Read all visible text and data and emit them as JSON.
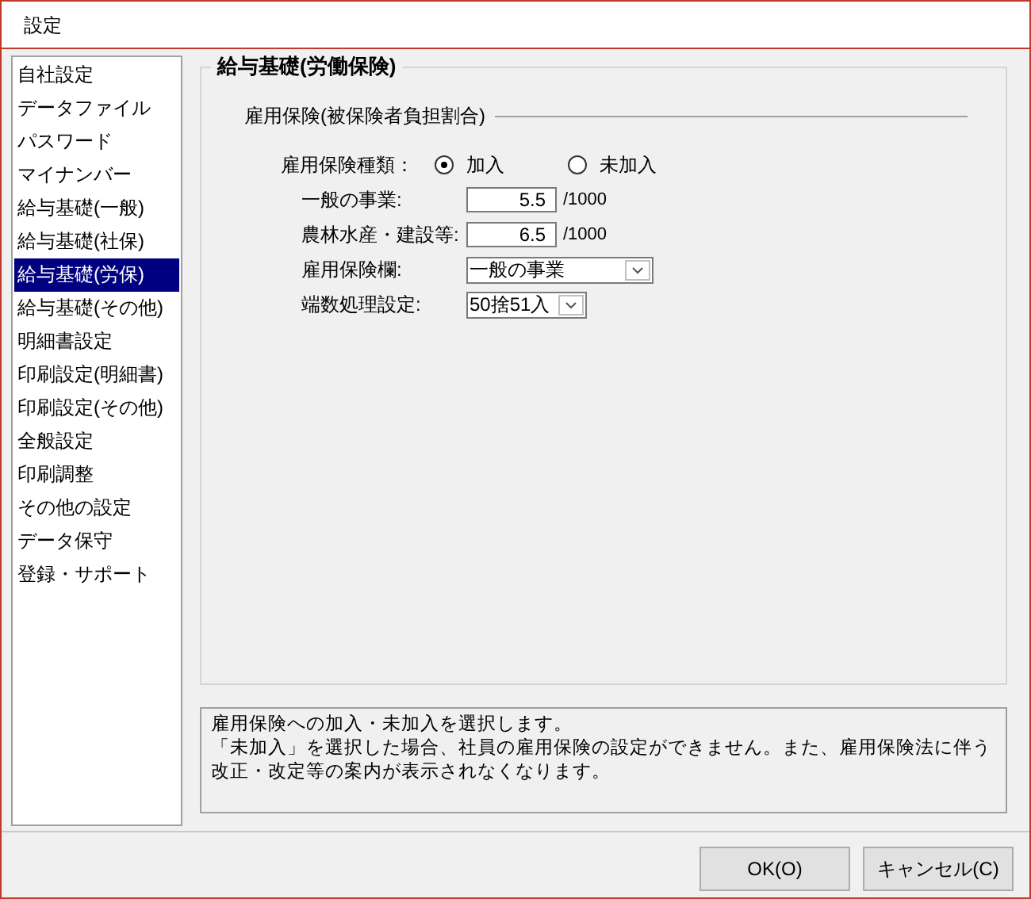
{
  "window": {
    "title": "設定"
  },
  "sidebar": {
    "items": [
      {
        "label": "自社設定",
        "selected": false
      },
      {
        "label": "データファイル",
        "selected": false
      },
      {
        "label": "パスワード",
        "selected": false
      },
      {
        "label": "マイナンバー",
        "selected": false
      },
      {
        "label": "給与基礎(一般)",
        "selected": false
      },
      {
        "label": "給与基礎(社保)",
        "selected": false
      },
      {
        "label": "給与基礎(労保)",
        "selected": true
      },
      {
        "label": "給与基礎(その他)",
        "selected": false
      },
      {
        "label": "明細書設定",
        "selected": false
      },
      {
        "label": "印刷設定(明細書)",
        "selected": false
      },
      {
        "label": "印刷設定(その他)",
        "selected": false
      },
      {
        "label": "全般設定",
        "selected": false
      },
      {
        "label": "印刷調整",
        "selected": false
      },
      {
        "label": "その他の設定",
        "selected": false
      },
      {
        "label": "データ保守",
        "selected": false
      },
      {
        "label": "登録・サポート",
        "selected": false
      }
    ]
  },
  "panel": {
    "title": "給与基礎(労働保険)",
    "section": "雇用保険(被保険者負担割合)",
    "type_label": "雇用保険種類：",
    "options": [
      {
        "label": "加入",
        "selected": true
      },
      {
        "label": "未加入",
        "selected": false
      }
    ],
    "fields": [
      {
        "kind": "rate",
        "label": "一般の事業:",
        "value": "5.5",
        "unit": "/1000"
      },
      {
        "kind": "rate",
        "label": "農林水産・建設等:",
        "value": "6.5",
        "unit": "/1000"
      },
      {
        "kind": "select",
        "label": "雇用保険欄:",
        "value": "一般の事業"
      },
      {
        "kind": "select_small",
        "label": "端数処理設定:",
        "value": "50捨51入"
      }
    ]
  },
  "help": [
    "雇用保険への加入・未加入を選択します。",
    "「未加入」を選択した場合、社員の雇用保険の設定ができません。また、雇用保険法に伴う改正・改定等の案内が表示されなくなります。"
  ],
  "buttons": [
    "OK(O)",
    "キャンセル(C)"
  ]
}
